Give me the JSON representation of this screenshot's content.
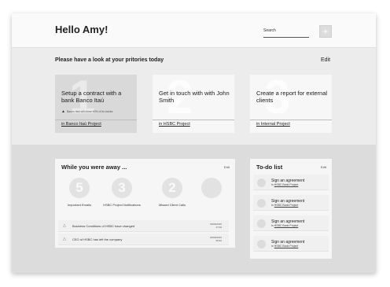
{
  "header": {
    "greeting": "Hello Amy!",
    "search_label": "Search",
    "add_label": "+"
  },
  "priorities": {
    "title": "Please have a look at your pritories today",
    "edit_label": "Edit",
    "cards": [
      {
        "number": "1",
        "title": "Setup a contract with a bank Banco Itaú",
        "warning": "Banco Itaú will close 60% of its banks",
        "project": "in Banco Itaú Project"
      },
      {
        "number": "2",
        "title": "Get in touch with with John Smith",
        "project": "in HSBC Project"
      },
      {
        "number": "3",
        "title": "Create a report for external clients",
        "project": "in Internal Project"
      }
    ]
  },
  "away": {
    "title": "While you were away ...",
    "edit_label": "Edit",
    "stats": [
      {
        "value": "5",
        "label": "Important Emails"
      },
      {
        "value": "3",
        "label": "HSBC Project Notifications"
      },
      {
        "value": "2",
        "label": "Missed Client Calls"
      },
      {
        "value": "",
        "label": ""
      }
    ],
    "notifications": [
      {
        "text": "Business Conditions of HSBC have changed",
        "date": "18/06/2016",
        "time": "17:00"
      },
      {
        "text": "CEO of HSBC has left the company",
        "date": "18/06/2016",
        "time": "09:40"
      }
    ]
  },
  "todo": {
    "title": "To-do list",
    "edit_label": "Edit",
    "items": [
      {
        "title": "Sign an agreement",
        "prefix": "in",
        "project": "HSBC Bank Project"
      },
      {
        "title": "Sign an agreement",
        "prefix": "in",
        "project": "HSBC Bank Project"
      },
      {
        "title": "Sign an agreement",
        "prefix": "in",
        "project": "HSBC Bank Project"
      },
      {
        "title": "Sign an agreement",
        "prefix": "in",
        "project": "HSBC Bank Project"
      }
    ]
  },
  "icons": {
    "warning": "warning-triangle-icon",
    "add": "plus-icon"
  }
}
